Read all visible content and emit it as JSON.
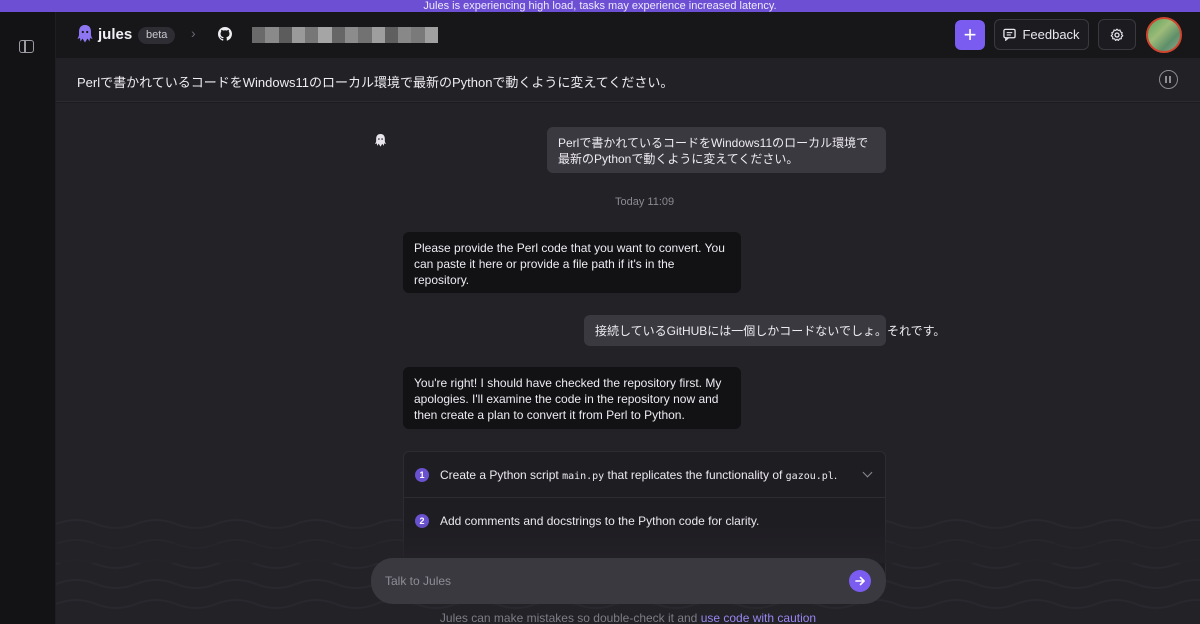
{
  "banner": {
    "text": "Jules is experiencing high load, tasks may experience increased latency."
  },
  "header": {
    "brand": "jules",
    "badge": "beta",
    "separator": "›",
    "repo_icon": "github-icon",
    "new_task_label": "+",
    "feedback_label": "Feedback",
    "settings_icon": "gear-icon"
  },
  "task": {
    "title": "Perlで書かれているコードをWindows11のローカル環境で最新のPythonで動くように変えてください。"
  },
  "conversation": {
    "user_1": "Perlで書かれているコードをWindows11のローカル環境で最新のPythonで動くように変えてください。",
    "timestamp": "Today 11:09",
    "agent_1": "Please provide the Perl code that you want to convert. You can paste it here or provide a file path if it's in the repository.",
    "user_2": "接続しているGitHUBには一個しかコードないでしょ。それです。",
    "agent_2": "You're right! I should have checked the repository first. My apologies. I'll examine the code in the repository now and then create a plan to convert it from Perl to Python."
  },
  "plan": {
    "steps": [
      {
        "number": "1",
        "text_a": "Create a Python script ",
        "code_a": "main.py",
        "text_b": " that replicates the functionality of ",
        "code_b": "gazou.pl",
        "text_c": "."
      },
      {
        "number": "2",
        "text": "Add comments and docstrings to the Python code for clarity."
      }
    ]
  },
  "composer": {
    "placeholder": "Talk to Jules",
    "send_icon": "arrow-right-icon"
  },
  "footer": {
    "disclaimer_text": "Jules can make mistakes so double-check it and ",
    "disclaimer_link": "use code with caution"
  },
  "colors": {
    "accent": "#7b5cf0",
    "banner": "#6d4fd3",
    "background": "#232227"
  }
}
